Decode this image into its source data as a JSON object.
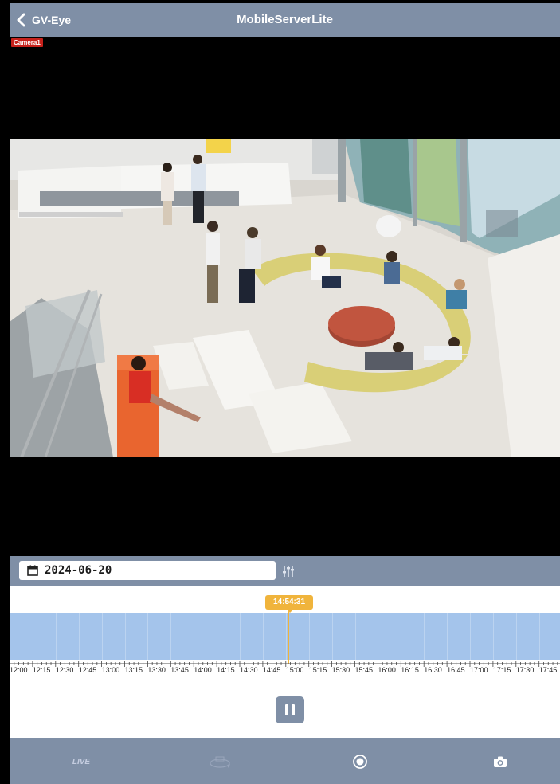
{
  "navbar": {
    "back_label": "GV-Eye",
    "title": "MobileServerLite"
  },
  "video": {
    "camera_label": "Camera1"
  },
  "datebar": {
    "date": "2024-06-20"
  },
  "timeline": {
    "current_time": "14:54:31",
    "tick_labels": [
      "12:00",
      "12:15",
      "12:30",
      "12:45",
      "13:00",
      "13:15",
      "13:30",
      "13:45",
      "14:00",
      "14:15",
      "14:30",
      "14:45",
      "15:00",
      "15:15",
      "15:30",
      "15:45",
      "16:00",
      "16:15",
      "16:30",
      "16:45",
      "17:00",
      "17:15",
      "17:30",
      "17:45"
    ]
  },
  "toolbar": {
    "live_label": "LIVE"
  },
  "colors": {
    "bar": "#7f8fa6",
    "recording": "#a4c4eb",
    "cursor": "#f0b43c",
    "camera_badge": "#c6211b"
  }
}
